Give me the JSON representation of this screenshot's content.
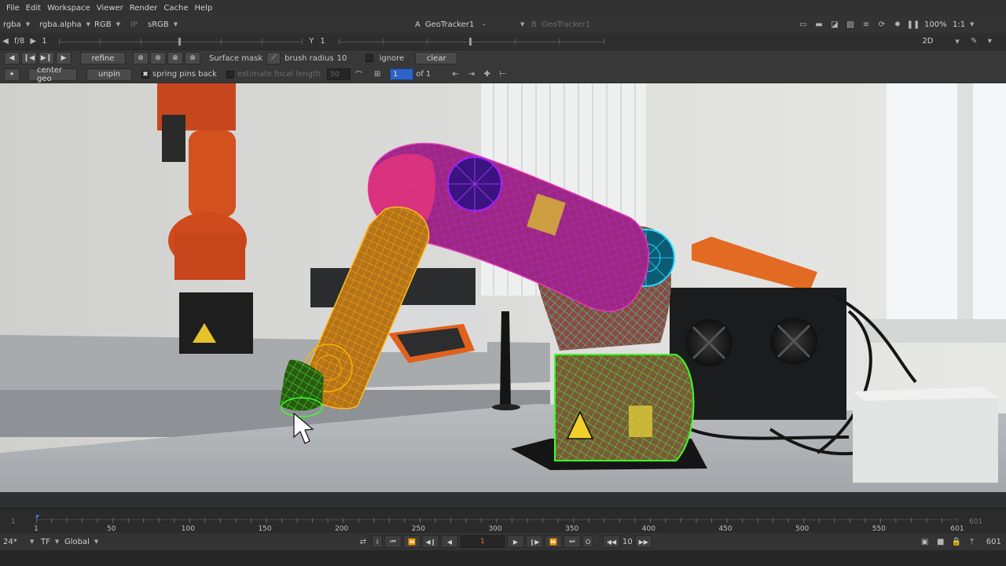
{
  "menu": [
    "File",
    "Edit",
    "Workspace",
    "Viewer",
    "Render",
    "Cache",
    "Help"
  ],
  "viewer_controls": {
    "channels": "rgba",
    "alpha": "rgba.alpha",
    "display": "RGB",
    "ip": "IP",
    "colorspace": "sRGB",
    "input_a_letter": "A",
    "input_a": "GeoTracker1",
    "input_op": "-",
    "input_b_letter": "B",
    "input_b": "GeoTracker1",
    "zoom": "100%",
    "ratio": "1:1",
    "view_mode": "2D"
  },
  "row2": {
    "fstop": "f/8",
    "gain_value": "1",
    "gamma_label": "Y",
    "gamma_value": "1"
  },
  "tracker_toolbar": {
    "refine_label": "refine",
    "surface_mask_label": "Surface mask",
    "brush_radius_label": "brush radius",
    "brush_radius_value": "10",
    "ignore_label": "ignore",
    "clear_label": "clear"
  },
  "geo_toolbar": {
    "center_geo_label": "center geo",
    "unpin_label": "unpin",
    "spring_pins_back_label": "spring pins back",
    "spring_pins_back_checked": true,
    "estimate_focal_length_label": "estimate focal length",
    "focal_value": "50",
    "keyframe_value": "1",
    "keyframe_of": "of",
    "keyframe_total": "1"
  },
  "timeline": {
    "start": "1",
    "end": "601",
    "current_frame": 1,
    "labels": [
      "1",
      "50",
      "100",
      "150",
      "200",
      "250",
      "300",
      "350",
      "400",
      "450",
      "500",
      "550",
      "601"
    ]
  },
  "playback": {
    "fps": "24*",
    "timecode_mode": "TF",
    "scope": "Global",
    "frame": "1",
    "step": "10",
    "end_frame": "601"
  },
  "colors": {
    "accent_blue": "#2f63c7",
    "frame_orange": "#e07a2a",
    "wire_green": "#37ff2a",
    "wire_cyan": "#22d9ff",
    "wire_magenta": "#d21aff",
    "wire_orange": "#ffae00"
  }
}
